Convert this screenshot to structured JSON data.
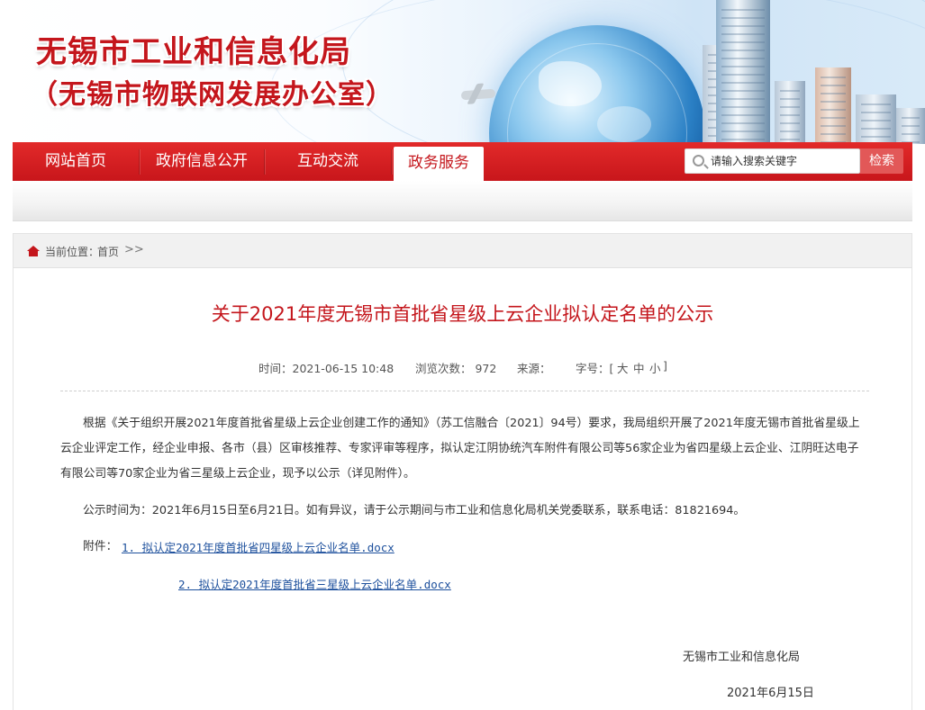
{
  "banner": {
    "title": "无锡市工业和信息化局",
    "subtitle": "（无锡市物联网发展办公室）"
  },
  "nav": {
    "items": [
      {
        "label": "网站首页"
      },
      {
        "label": "政府信息公开"
      },
      {
        "label": "互动交流"
      },
      {
        "label": "政务服务"
      }
    ],
    "active_index": 3
  },
  "search": {
    "placeholder": "请输入搜索关键字",
    "button_label": "检索"
  },
  "breadcrumb": {
    "label": "当前位置：",
    "home": "首页",
    "arrow": ">>"
  },
  "article": {
    "title": "关于2021年度无锡市首批省星级上云企业拟认定名单的公示",
    "meta": {
      "time": "时间：2021-06-15 10:48",
      "views": "浏览次数：  972",
      "source": "来源：",
      "font_size_label": "字号：[",
      "size_large": "大",
      "size_medium": "中",
      "size_small": "小",
      "font_size_end": "]"
    },
    "paragraph1": "根据《关于组织开展2021年度首批省星级上云企业创建工作的通知》（苏工信融合〔2021〕94号）要求，我局组织开展了2021年度无锡市首批省星级上云企业评定工作，经企业申报、各市（县）区审核推荐、专家评审等程序，拟认定江阴协统汽车附件有限公司等56家企业为省四星级上云企业、江阴旺达电子有限公司等70家企业为省三星级上云企业，现予以公示（详见附件）。",
    "paragraph2": "公示时间为：2021年6月15日至6月21日。如有异议，请于公示期间与市工业和信息化局机关党委联系，联系电话：81821694。",
    "attachments_label": "附件：",
    "attachments": [
      {
        "label": "1. 拟认定2021年度首批省四星级上云企业名单.docx"
      },
      {
        "label": "2. 拟认定2021年度首批省三星级上云企业名单.docx"
      }
    ],
    "signature": "无锡市工业和信息化局",
    "date": "2021年6月15日"
  },
  "colors": {
    "brand_red": "#c4161c",
    "link_blue": "#1c4f9c"
  }
}
